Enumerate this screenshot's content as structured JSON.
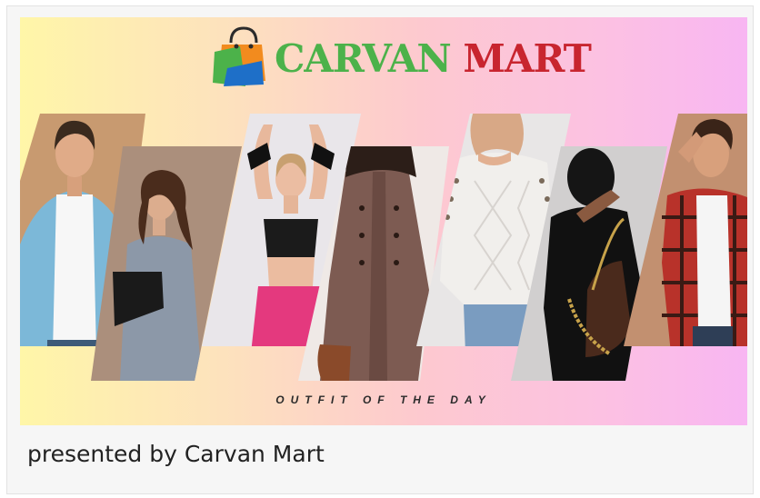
{
  "banner": {
    "brand_word_1": "CARVAN",
    "brand_word_2": "MART",
    "tagline": "OUTFIT OF THE DAY",
    "colors": {
      "brand_green": "#4cb24a",
      "brand_red": "#c8252f",
      "gradient_left": "#fff6a8",
      "gradient_right": "#f8b6f2"
    },
    "icons": [
      "shopping-bag-logo-icon"
    ],
    "photos": [
      "man-denim-shirt",
      "woman-grey-dress",
      "woman-black-crop-top",
      "woman-brown-coat",
      "woman-white-sweater",
      "woman-black-shirt",
      "man-plaid-shirt"
    ]
  },
  "caption": "presented by Carvan Mart"
}
